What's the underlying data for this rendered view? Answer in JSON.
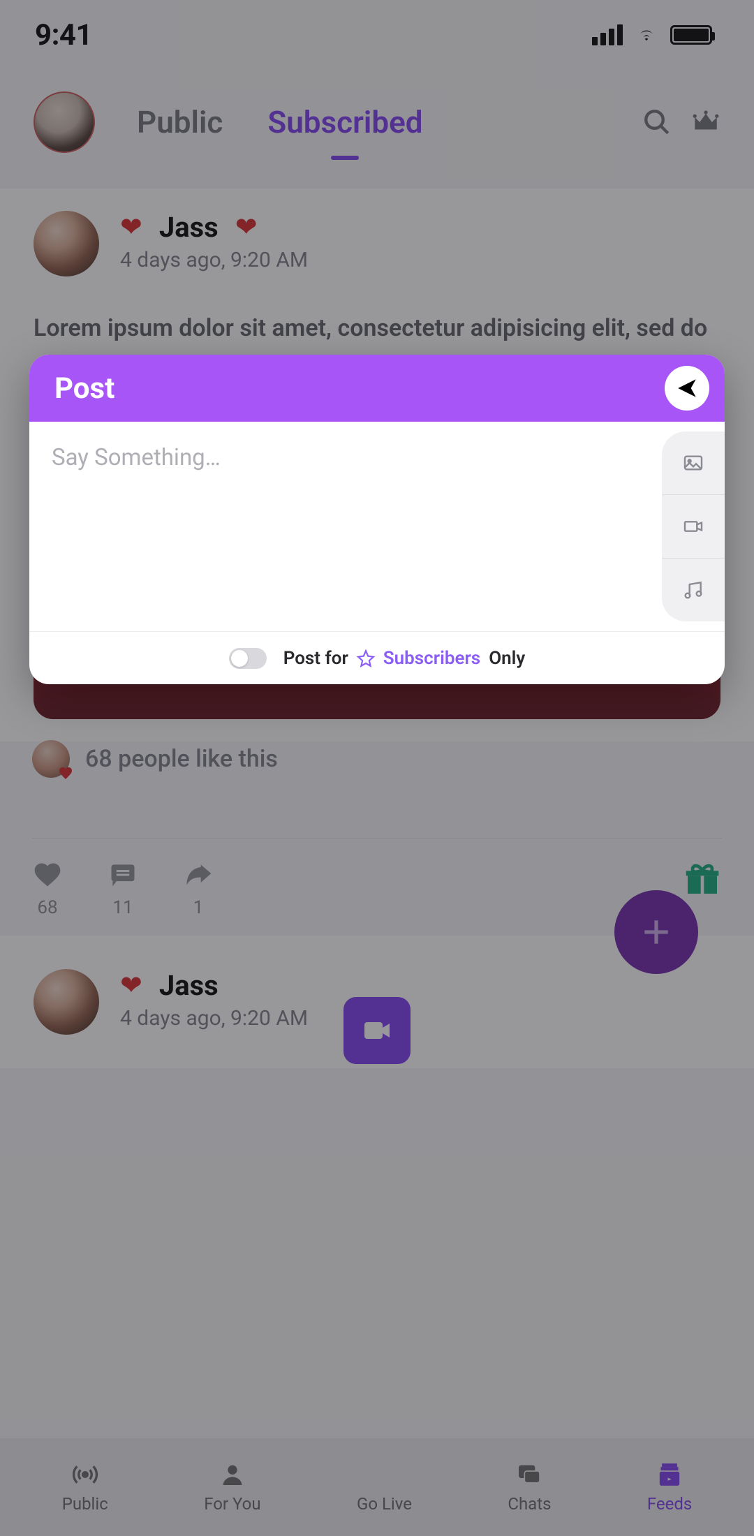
{
  "status": {
    "time": "9:41"
  },
  "header": {
    "tabs": {
      "public": "Public",
      "subscribed": "Subscribed"
    }
  },
  "post1": {
    "name": "Jass",
    "time": "4 days ago, 9:20 AM",
    "body": "Lorem ipsum dolor sit amet, consectetur adipisicing elit, sed do eiusmod tempor incididunt  quis nostrud exercitation ullamco laboris nisi ut  😍 😍 😍",
    "likes_text": "68 people like this",
    "actions": {
      "likes": "68",
      "comments": "11",
      "shares": "1"
    }
  },
  "post2": {
    "name": "Jass",
    "time": "4 days ago, 9:20 AM"
  },
  "modal": {
    "title": "Post",
    "placeholder": "Say Something…",
    "footer": {
      "post_for": "Post for",
      "subscribers": "Subscribers",
      "only": "Only"
    }
  },
  "bottom_nav": {
    "public": "Public",
    "for_you": "For You",
    "go_live": "Go Live",
    "chats": "Chats",
    "feeds": "Feeds"
  }
}
